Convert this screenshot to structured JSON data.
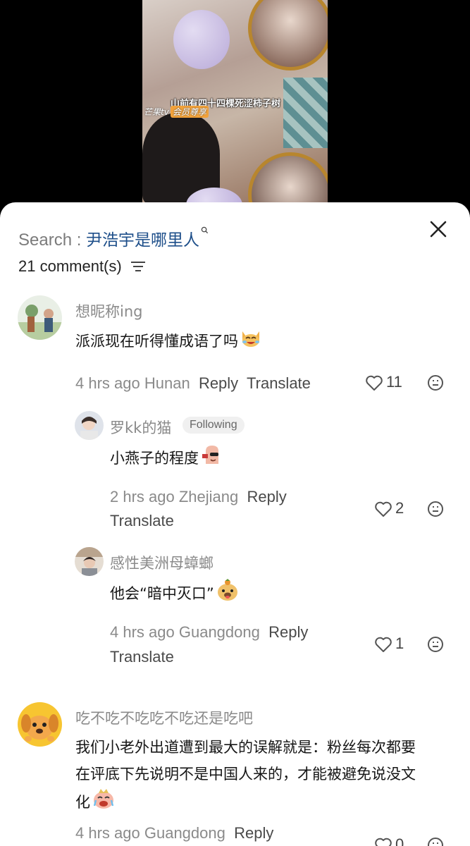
{
  "video": {
    "subtitle": "山前有四十四棵死涩柿子树",
    "watermark_brand": "芒果tv",
    "watermark_vip": "会员尊享"
  },
  "search": {
    "prefix": "Search : ",
    "term": "尹浩宇是哪里人"
  },
  "comments_header": {
    "count_label": "21 comment(s)"
  },
  "comments": [
    {
      "username": "想昵称ing",
      "text": "派派现在听得懂成语了吗",
      "time": "4 hrs ago",
      "location": "Hunan",
      "reply_label": "Reply",
      "translate_label": "Translate",
      "likes": "11"
    },
    {
      "username": "罗kk的猫",
      "badge": "Following",
      "text": "小燕子的程度",
      "time": "2 hrs ago",
      "location": "Zhejiang",
      "reply_label": "Reply",
      "translate_label": "Translate",
      "likes": "2"
    },
    {
      "username": "感性美洲母蟑螂",
      "text": "他会“暗中灭口”",
      "time": "4 hrs ago",
      "location": "Guangdong",
      "reply_label": "Reply",
      "translate_label": "Translate",
      "likes": "1"
    },
    {
      "username": "吃不吃不吃吃不吃还是吃吧",
      "text_line1": "我们小老外出道遭到最大的误解就是：粉丝每次都要",
      "text_line2": "在评底下先说明不是中国人来的，才能被避免说没文",
      "text_line3": "化",
      "time": "4 hrs ago",
      "location": "Guangdong",
      "reply_label": "Reply",
      "likes": "0"
    }
  ],
  "icons": {
    "close": "close-icon",
    "sort": "sort-icon",
    "like": "heart-icon",
    "emoji": "emoji-reaction-icon"
  }
}
